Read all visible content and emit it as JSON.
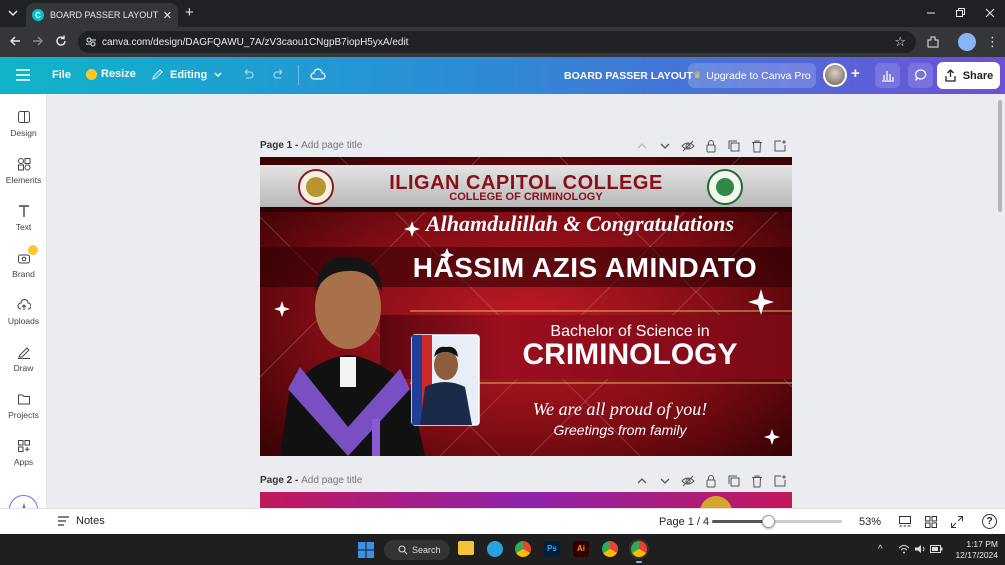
{
  "browser": {
    "tab_title": "BOARD PASSER LAYOUT - 16 ×",
    "tab_favicon": "C",
    "url": "canva.com/design/DAGFQAWU_7A/zV3caou1CNgpB7iopH5yxA/edit"
  },
  "header": {
    "file": "File",
    "resize": "Resize",
    "editing": "Editing",
    "design_title": "BOARD PASSER LAYOUT",
    "upgrade": "Upgrade to Canva Pro",
    "share": "Share"
  },
  "sidebar": {
    "items": [
      {
        "label": "Design"
      },
      {
        "label": "Elements"
      },
      {
        "label": "Text"
      },
      {
        "label": "Brand"
      },
      {
        "label": "Uploads"
      },
      {
        "label": "Draw"
      },
      {
        "label": "Projects"
      },
      {
        "label": "Apps"
      }
    ]
  },
  "pages": [
    {
      "label": "Page 1 -",
      "placeholder": "Add page title"
    },
    {
      "label": "Page 2 -",
      "placeholder": "Add page title"
    }
  ],
  "design": {
    "college": "ILIGAN CAPITOL COLLEGE",
    "department": "COLLEGE OF CRIMINOLOGY",
    "greeting": "Alhamdulillah & Congratulations",
    "name": "HASSIM AZIS AMINDATO",
    "degree_line1": "Bachelor of Science in",
    "degree_line2": "CRIMINOLOGY",
    "proud": "We are all proud of you!",
    "from": "Greetings from family"
  },
  "bottom": {
    "notes": "Notes",
    "page_indicator": "Page 1 / 4",
    "zoom": "53%",
    "zoom_level": 0.43,
    "help": "?"
  },
  "taskbar": {
    "search": "Search",
    "time": "1:17 PM",
    "date": "12/17/2024"
  },
  "colors": {
    "canva_teal": "#0fb4c9",
    "canva_purple": "#6d50d8",
    "design_red": "#7a0d12",
    "degree_band": "#9b0f1f"
  }
}
